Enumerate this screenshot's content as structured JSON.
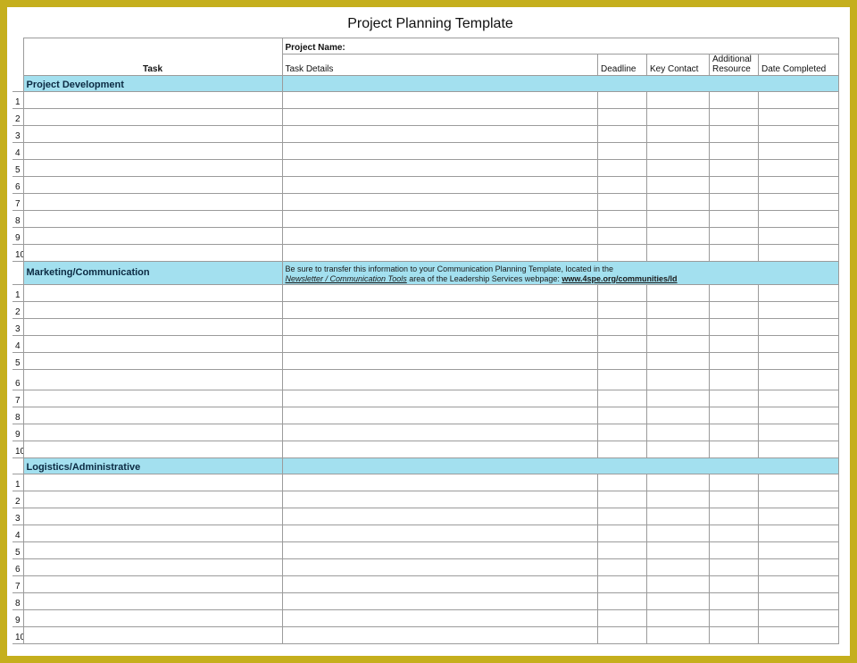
{
  "title": "Project Planning Template",
  "header": {
    "project_name_label": "Project Name:",
    "task_label": "Task",
    "task_details_label": "Task Details",
    "deadline_label": "Deadline",
    "key_contact_label": "Key Contact",
    "additional_resource_label_line1": "Additional",
    "additional_resource_label_line2": "Resource",
    "date_completed_label": "Date Completed"
  },
  "sections": [
    {
      "name": "Project Development",
      "note_html": "",
      "rows": 10
    },
    {
      "name": "Marketing/Communication",
      "note_line1": "Be sure to transfer this information to your Communication Planning Template, located in the",
      "note_line2_a": "Newsletter / Communication Tools",
      "note_line2_b": " area of the Leadership Services webpage: ",
      "note_link": "www.4spe.org/communities/ld",
      "rows": 10
    },
    {
      "name": "Logistics/Administrative",
      "note_html": "",
      "rows": 10
    }
  ],
  "row_numbers": [
    "1",
    "2",
    "3",
    "4",
    "5",
    "6",
    "7",
    "8",
    "9",
    "10"
  ]
}
